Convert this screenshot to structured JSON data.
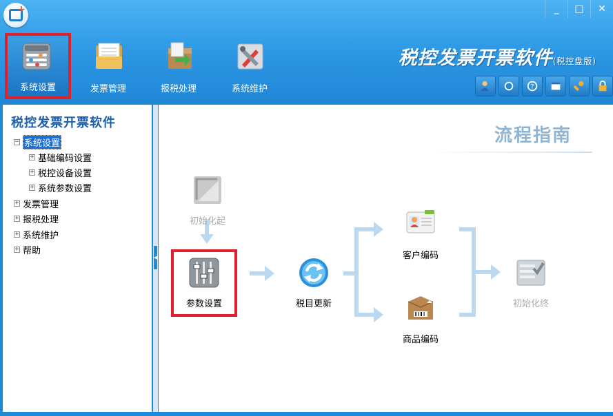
{
  "window": {
    "minimize": "_",
    "maximize": "□",
    "close": "✕"
  },
  "nav": {
    "system_settings": "系统设置",
    "invoice_management": "发票管理",
    "tax_filing": "报税处理",
    "system_maintenance": "系统维护"
  },
  "app_title": {
    "main": "税控发票开票软件",
    "sub": "(税控盘版)"
  },
  "tree": {
    "title": "税控发票开票软件",
    "items": [
      {
        "toggle": "−",
        "label": "系统设置"
      },
      {
        "toggle": "+",
        "label": "基础编码设置"
      },
      {
        "toggle": "+",
        "label": "税控设备设置"
      },
      {
        "toggle": "+",
        "label": "系统参数设置"
      },
      {
        "toggle": "+",
        "label": "发票管理"
      },
      {
        "toggle": "+",
        "label": "报税处理"
      },
      {
        "toggle": "+",
        "label": "系统维护"
      },
      {
        "toggle": "+",
        "label": "帮助"
      }
    ]
  },
  "guide": {
    "title": "流程指南",
    "steps": {
      "init_start": "初始化起",
      "params": "参数设置",
      "tax_items": "税目更新",
      "customer": "客户编码",
      "goods": "商品编码",
      "init_end": "初始化终"
    }
  },
  "colors": {
    "header_blue": "#2f9ae6",
    "highlight_red": "#e0202a",
    "tree_title": "#1b5fab",
    "arrow": "#bcd8ee"
  }
}
